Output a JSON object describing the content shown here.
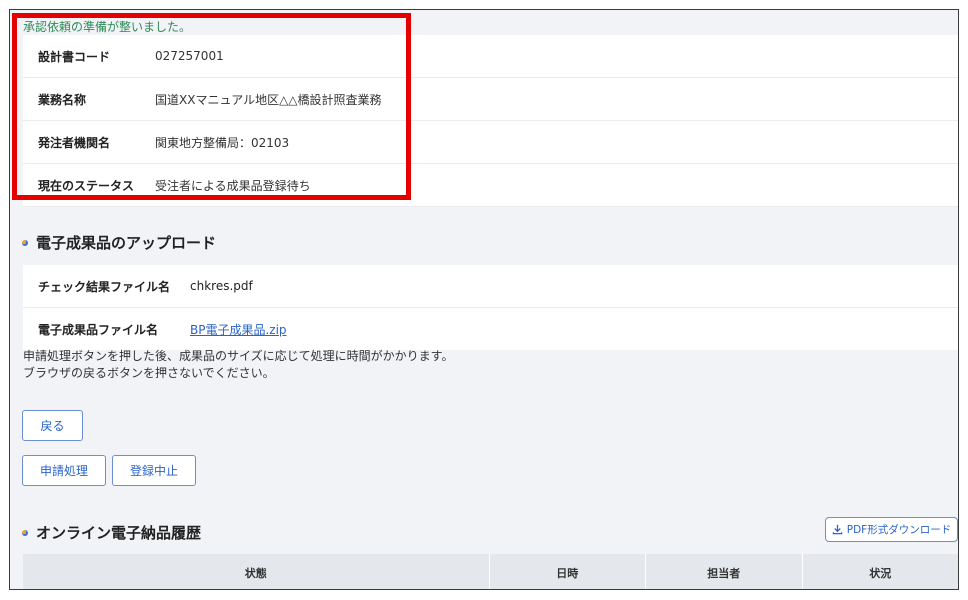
{
  "success_message": "承認依頼の準備が整いました。",
  "info": [
    {
      "label": "設計書コード",
      "value": "027257001"
    },
    {
      "label": "業務名称",
      "value": "国道XXマニュアル地区△△橋設計照査業務"
    },
    {
      "label": "発注者機関名",
      "value": "関東地方整備局：02103"
    },
    {
      "label": "現在のステータス",
      "value": "受注者による成果品登録待ち"
    }
  ],
  "upload": {
    "title": "電子成果品のアップロード",
    "check_file_label": "チェック結果ファイル名",
    "check_file_value": "chkres.pdf",
    "deliverable_label": "電子成果品ファイル名",
    "deliverable_value": "BP電子成果品.zip"
  },
  "notes": [
    "申請処理ボタンを押した後、成果品のサイズに応じて処理に時間がかかります。",
    "ブラウザの戻るボタンを押さないでください。"
  ],
  "buttons": {
    "back": "戻る",
    "apply": "申請処理",
    "cancel": "登録中止"
  },
  "history": {
    "title": "オンライン電子納品履歴",
    "pdf_download": "PDF形式ダウンロード",
    "columns": [
      "状態",
      "日時",
      "担当者",
      "状況"
    ]
  },
  "colors": {
    "highlight": "#e50000",
    "link": "#2a63c9",
    "success": "#2e8b57"
  }
}
